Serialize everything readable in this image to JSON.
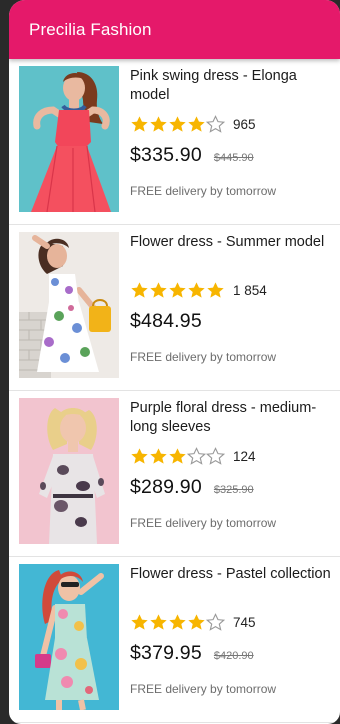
{
  "app": {
    "title": "Precilia Fashion",
    "accent_color": "#e5196a",
    "star_color": "#f7b500"
  },
  "products": [
    {
      "name": "Pink swing dress - Elonga model",
      "rating": 4,
      "rating_count": "965",
      "price": "$335.90",
      "old_price": "$445.90",
      "delivery": "FREE delivery by tomorrow",
      "image": "woman-in-pink-dress"
    },
    {
      "name": "Flower dress - Summer model",
      "rating": 5,
      "rating_count": "1 854",
      "price": "$484.95",
      "old_price": "",
      "delivery": "FREE delivery by tomorrow",
      "image": "woman-in-floral-dress-with-yellow-bag"
    },
    {
      "name": "Purple floral dress - medium-long sleeves",
      "rating": 3,
      "rating_count": "124",
      "price": "$289.90",
      "old_price": "$325.90",
      "delivery": "FREE delivery by tomorrow",
      "image": "woman-in-grey-floral-dress"
    },
    {
      "name": "Flower dress - Pastel collection",
      "rating": 4,
      "rating_count": "745",
      "price": "$379.95",
      "old_price": "$420.90",
      "delivery": "FREE delivery by tomorrow",
      "image": "woman-in-pastel-floral-dress"
    }
  ]
}
